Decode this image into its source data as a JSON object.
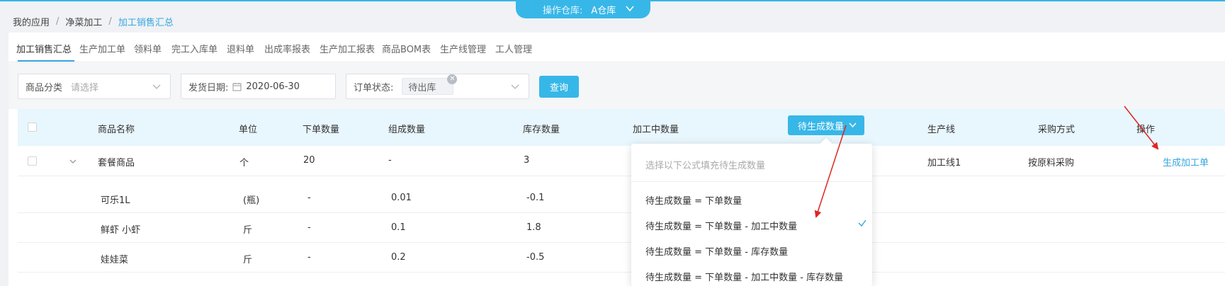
{
  "breadcrumb": {
    "items": [
      "我的应用",
      "净菜加工",
      "加工销售汇总"
    ],
    "separator": "/"
  },
  "warehouse": {
    "label": "操作仓库:",
    "value": "A仓库"
  },
  "tabs": [
    "加工销售汇总",
    "生产加工单",
    "领料单",
    "完工入库单",
    "退料单",
    "出成率报表",
    "生产加工报表",
    "商品BOM表",
    "生产线管理",
    "工人管理"
  ],
  "filters": {
    "category_label": "商品分类",
    "category_placeholder": "请选择",
    "date_label": "发货日期:",
    "date_value": "2020-06-30",
    "status_label": "订单状态:",
    "status_tag": "待出库",
    "query_label": "查询"
  },
  "table": {
    "headers": {
      "name": "商品名称",
      "unit": "单位",
      "order_qty": "下单数量",
      "compose_qty": "组成数量",
      "stock_qty": "库存数量",
      "processing_qty": "加工中数量",
      "pending_qty": "待生成数量",
      "line": "生产线",
      "purchase": "采购方式",
      "action": "操作"
    },
    "main_row": {
      "name": "套餐商品",
      "unit": "个",
      "order_qty": "20",
      "compose_qty": "-",
      "stock_qty": "3",
      "line": "加工线1",
      "purchase": "按原料采购",
      "action": "生成加工单"
    },
    "sub_rows": [
      {
        "name": "可乐1L",
        "unit": "(瓶)",
        "order_qty": "-",
        "compose_qty": "0.01",
        "stock_qty": "-0.1"
      },
      {
        "name": "鲜虾 小虾",
        "unit": "斤",
        "order_qty": "-",
        "compose_qty": "0.1",
        "stock_qty": "1.8"
      },
      {
        "name": "娃娃菜",
        "unit": "斤",
        "order_qty": "-",
        "compose_qty": "0.2",
        "stock_qty": "-0.5"
      }
    ]
  },
  "dropdown": {
    "hint": "选择以下公式填充待生成数量",
    "options": [
      "待生成数量 = 下单数量",
      "待生成数量 = 下单数量 - 加工中数量",
      "待生成数量 = 下单数量 - 库存数量",
      "待生成数量 = 下单数量 - 加工中数量 - 库存数量"
    ],
    "selected_index": 1
  },
  "colors": {
    "accent": "#37b7e8",
    "link": "#37a6df",
    "arrow": "#e02424"
  }
}
